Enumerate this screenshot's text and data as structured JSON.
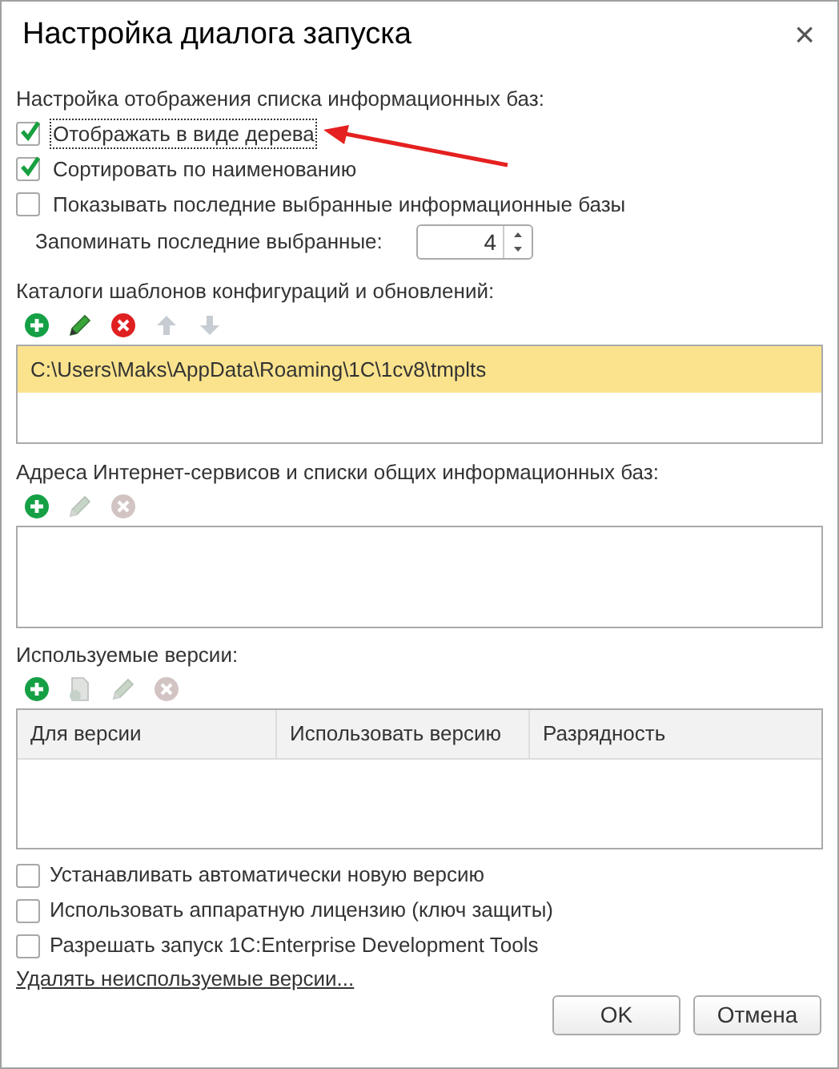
{
  "window": {
    "title": "Настройка диалога запуска",
    "close": "×"
  },
  "display": {
    "label": "Настройка отображения списка информационных баз:",
    "checkboxes": [
      {
        "label": "Отображать в виде дерева",
        "checked": true,
        "focused": true
      },
      {
        "label": "Сортировать по наименованию",
        "checked": true,
        "focused": false
      },
      {
        "label": "Показывать последние выбранные информационные базы",
        "checked": false,
        "focused": false
      }
    ],
    "remember": {
      "label": "Запоминать последние выбранные:",
      "value": "4"
    }
  },
  "templates": {
    "label": "Каталоги шаблонов конфигураций и обновлений:",
    "toolbar": [
      {
        "kind": "add",
        "disabled": false
      },
      {
        "kind": "edit",
        "disabled": false
      },
      {
        "kind": "delete",
        "disabled": false
      },
      {
        "kind": "up",
        "disabled": true
      },
      {
        "kind": "down",
        "disabled": true
      }
    ],
    "rows": [
      {
        "text": "C:\\Users\\Maks\\AppData\\Roaming\\1C\\1cv8\\tmplts",
        "selected": true
      }
    ]
  },
  "services": {
    "label": "Адреса Интернет-сервисов и списки общих информационных баз:",
    "toolbar": [
      {
        "kind": "add",
        "disabled": false
      },
      {
        "kind": "edit",
        "disabled": true
      },
      {
        "kind": "delete",
        "disabled": true
      }
    ]
  },
  "versions": {
    "label": "Используемые версии:",
    "toolbar": [
      {
        "kind": "add",
        "disabled": false
      },
      {
        "kind": "copy",
        "disabled": true
      },
      {
        "kind": "edit",
        "disabled": true
      },
      {
        "kind": "delete",
        "disabled": true
      }
    ],
    "columns": [
      "Для версии",
      "Использовать версию",
      "Разрядность"
    ]
  },
  "options": [
    {
      "label": "Устанавливать автоматически новую версию",
      "checked": false
    },
    {
      "label": "Использовать аппаратную лицензию (ключ защиты)",
      "checked": false
    },
    {
      "label": "Разрешать запуск 1C:Enterprise Development Tools",
      "checked": false
    }
  ],
  "link": "Удалять неиспользуемые версии...",
  "buttons": [
    "OK",
    "Отмена"
  ]
}
